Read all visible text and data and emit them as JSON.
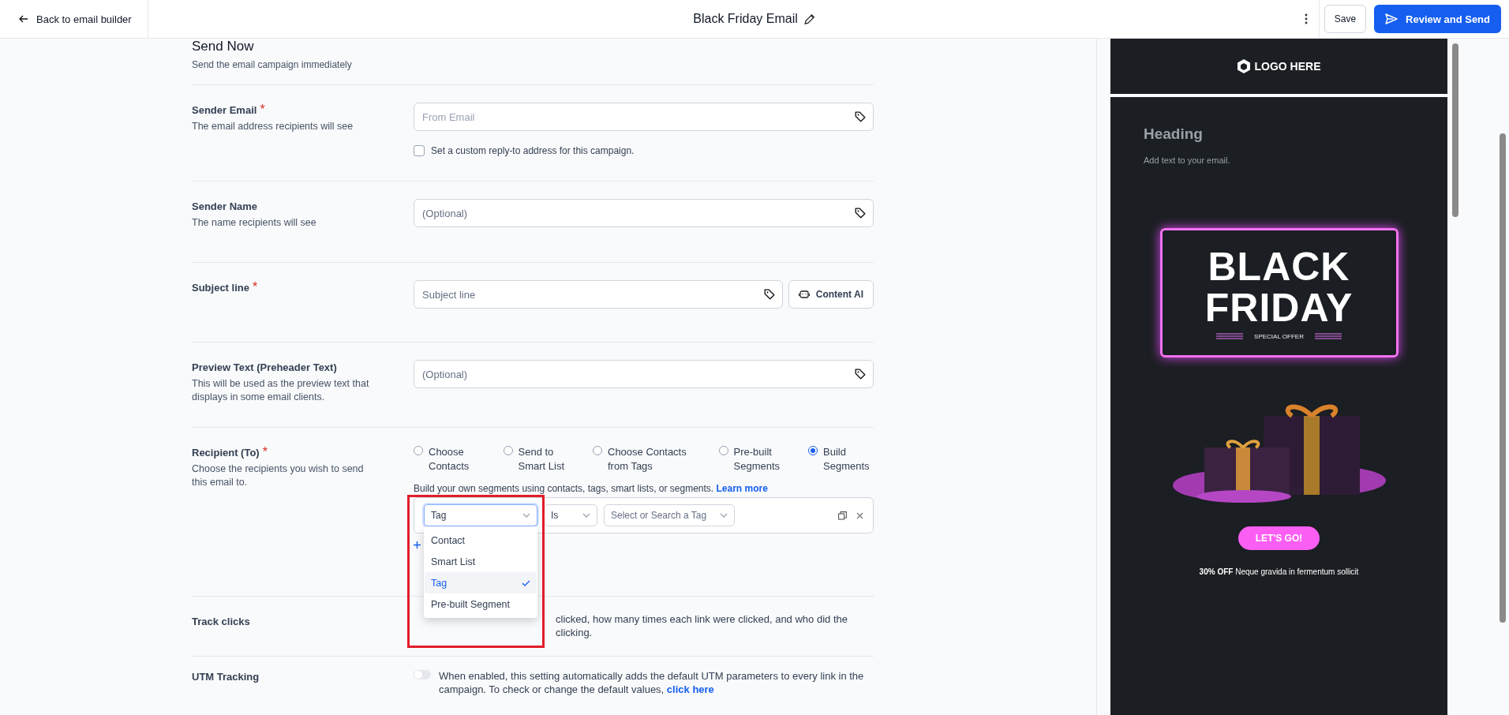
{
  "top_bar": {
    "back_label": "Back to email builder",
    "title": "Black Friday Email",
    "save_label": "Save",
    "send_label": "Review and Send"
  },
  "send_now": {
    "title": "Send Now",
    "subtitle": "Send the email campaign immediately"
  },
  "sender_email": {
    "label": "Sender Email",
    "required_mark": "*",
    "hint": "The email address recipients will see",
    "placeholder": "From Email",
    "reply_to": {
      "label": "Set a custom reply-to address for this campaign.",
      "checked": false
    }
  },
  "sender_name": {
    "label": "Sender Name",
    "hint": "The name recipients will see",
    "placeholder": "(Optional)"
  },
  "subject": {
    "label": "Subject line",
    "required_mark": "*",
    "placeholder": "Subject line",
    "ai_label": "Content AI"
  },
  "preview_text": {
    "label": "Preview Text (Preheader Text)",
    "hint": "This will be used as the preview text that displays in some email clients.",
    "placeholder": "(Optional)"
  },
  "recipient": {
    "label": "Recipient (To)",
    "required_mark": "*",
    "hint": "Choose the recipients you wish to send this email to.",
    "options": [
      {
        "label": "Choose Contacts",
        "selected": false
      },
      {
        "label": "Send to Smart List",
        "selected": false
      },
      {
        "label": "Choose Contacts from Tags",
        "selected": false
      },
      {
        "label": "Pre-built Segments",
        "selected": false
      },
      {
        "label": "Build Segments",
        "selected": true
      }
    ],
    "help": "Build your own segments using contacts, tags, smart lists, or segments.",
    "help_link": "Learn more",
    "segment": {
      "field": "Tag",
      "operator": "Is",
      "value_placeholder": "Select or Search a Tag"
    },
    "menu": [
      {
        "label": "Contact",
        "selected": false
      },
      {
        "label": "Smart List",
        "selected": false
      },
      {
        "label": "Tag",
        "selected": true
      },
      {
        "label": "Pre-built Segment",
        "selected": false
      }
    ]
  },
  "track_clicks": {
    "label": "Track clicks",
    "text": "clicked, how many times each link were clicked, and who did the clicking."
  },
  "utm": {
    "label": "UTM Tracking",
    "on": false,
    "text": "When enabled, this setting automatically adds the default UTM parameters to every link in the campaign. To check or change the default values,",
    "link": "click here"
  },
  "preview": {
    "logo": "LOGO HERE",
    "heading": "Heading",
    "body": "Add text to your email.",
    "banner_lines": [
      "BLACK",
      "FRIDAY"
    ],
    "banner_tag": "SPECIAL OFFER",
    "cta": "LET'S GO!",
    "footer": "**30% OFF** Neque gravida in fermentum sollicit"
  }
}
